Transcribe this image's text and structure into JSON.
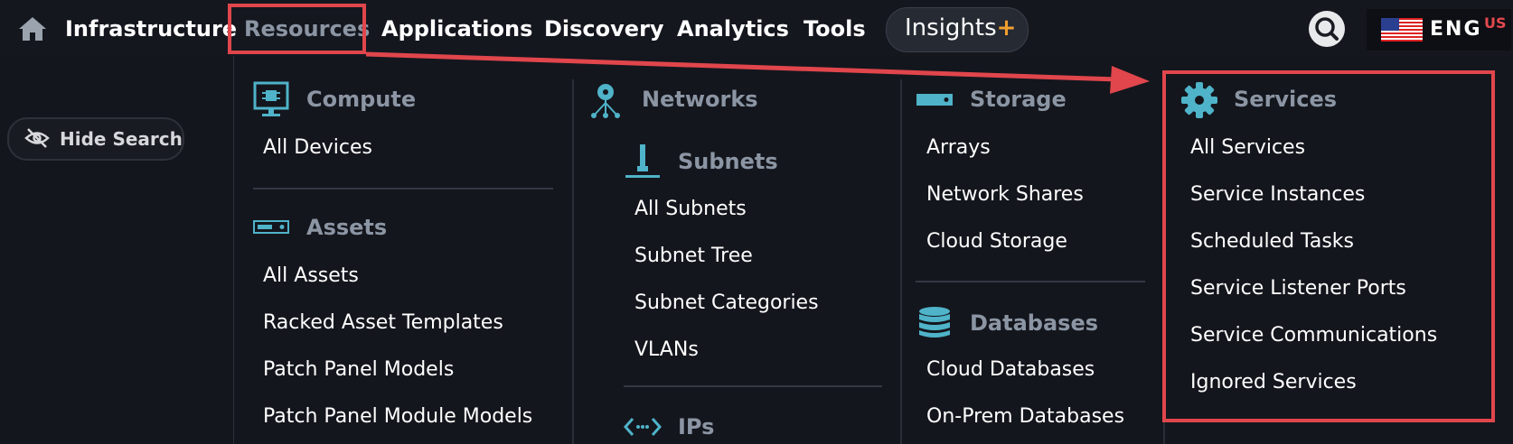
{
  "nav": {
    "items": [
      "Infrastructure",
      "Resources",
      "Applications",
      "Discovery",
      "Analytics",
      "Tools"
    ],
    "insights_label": "Insights",
    "insights_plus": "+",
    "language_code": "ENG",
    "language_region": "US"
  },
  "sidebar": {
    "hide_search_label": "Hide Search"
  },
  "menu": {
    "compute": {
      "title": "Compute",
      "items": [
        "All Devices"
      ]
    },
    "assets": {
      "title": "Assets",
      "items": [
        "All Assets",
        "Racked Asset Templates",
        "Patch Panel Models",
        "Patch Panel Module Models"
      ]
    },
    "networks": {
      "title": "Networks"
    },
    "subnets": {
      "title": "Subnets",
      "items": [
        "All Subnets",
        "Subnet Tree",
        "Subnet Categories",
        "VLANs"
      ]
    },
    "ips": {
      "title": "IPs"
    },
    "storage": {
      "title": "Storage",
      "items": [
        "Arrays",
        "Network Shares",
        "Cloud Storage"
      ]
    },
    "databases": {
      "title": "Databases",
      "items": [
        "Cloud Databases",
        "On-Prem Databases"
      ]
    },
    "services": {
      "title": "Services",
      "items": [
        "All Services",
        "Service Instances",
        "Scheduled Tasks",
        "Service Listener Ports",
        "Service Communications",
        "Ignored Services"
      ]
    }
  },
  "colors": {
    "accent": "#4fb3c9",
    "highlight": "#e0464c",
    "section_title": "#8b95a3",
    "background": "#14161d"
  }
}
